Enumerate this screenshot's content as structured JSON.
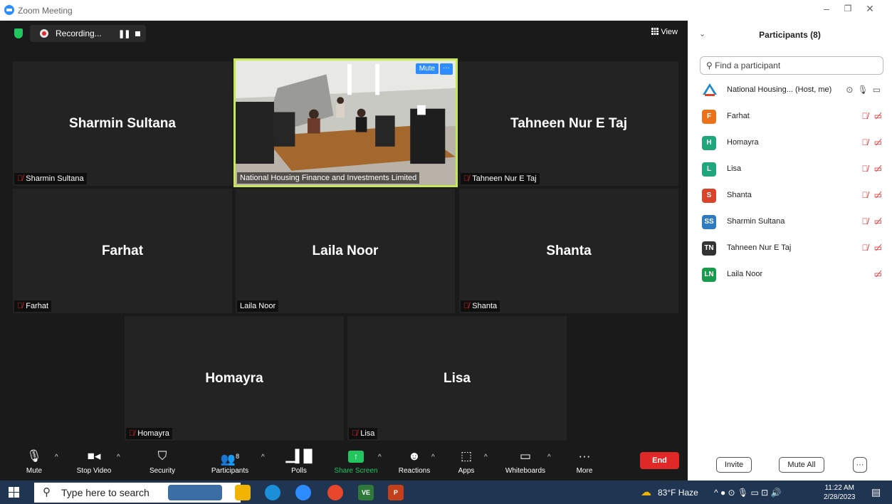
{
  "window": {
    "title": "Zoom Meeting"
  },
  "topbar": {
    "recording_label": "Recording...",
    "view_label": "View"
  },
  "tiles": [
    {
      "big_name": "Sharmin Sultana",
      "label": "Sharmin Sultana",
      "muted": true
    },
    {
      "big_name": "",
      "label": "National Housing Finance and Investments Limited",
      "muted": false,
      "video": true,
      "mute_chip": "Mute",
      "more_chip": "···"
    },
    {
      "big_name": "Tahneen Nur E Taj",
      "label": "Tahneen Nur E Taj",
      "muted": true
    },
    {
      "big_name": "Farhat",
      "label": "Farhat",
      "muted": true
    },
    {
      "big_name": "Laila Noor",
      "label": "Laila Noor",
      "muted": false
    },
    {
      "big_name": "Shanta",
      "label": "Shanta",
      "muted": true
    },
    {
      "big_name": "Homayra",
      "label": "Homayra",
      "muted": true
    },
    {
      "big_name": "Lisa",
      "label": "Lisa",
      "muted": true
    }
  ],
  "toolbar": {
    "mute": "Mute",
    "stop_video": "Stop Video",
    "security": "Security",
    "participants": "Participants",
    "participants_count": "8",
    "polls": "Polls",
    "share_screen": "Share Screen",
    "reactions": "Reactions",
    "apps": "Apps",
    "whiteboards": "Whiteboards",
    "more": "More",
    "end": "End"
  },
  "panel": {
    "title": "Participants (8)",
    "search_placeholder": "Find a participant",
    "host": {
      "name": "National Housing... (Host, me)"
    },
    "participants": [
      {
        "initials": "F",
        "name": "Farhat",
        "color": "#e8731a",
        "mic_off": true
      },
      {
        "initials": "H",
        "name": "Homayra",
        "color": "#1fa67a",
        "mic_off": true
      },
      {
        "initials": "L",
        "name": "Lisa",
        "color": "#1fa67a",
        "mic_off": true
      },
      {
        "initials": "S",
        "name": "Shanta",
        "color": "#d9442b",
        "mic_off": true
      },
      {
        "initials": "SS",
        "name": "Sharmin Sultana",
        "color": "#2f7bbf",
        "mic_off": true
      },
      {
        "initials": "TN",
        "name": "Tahneen Nur E Taj",
        "color": "#333333",
        "mic_off": true
      },
      {
        "initials": "LN",
        "name": "Laila Noor",
        "color": "#1a9a4c",
        "mic_off": false
      }
    ],
    "invite": "Invite",
    "mute_all": "Mute All",
    "more": "···"
  },
  "taskbar": {
    "search_placeholder": "Type here to search",
    "weather": "83°F  Haze",
    "time": "11:22 AM",
    "date": "2/28/2023"
  },
  "colors": {
    "accent": "#2d8cff",
    "end": "#e02828",
    "share": "#22c55e",
    "active_speaker": "#c8e65a"
  }
}
